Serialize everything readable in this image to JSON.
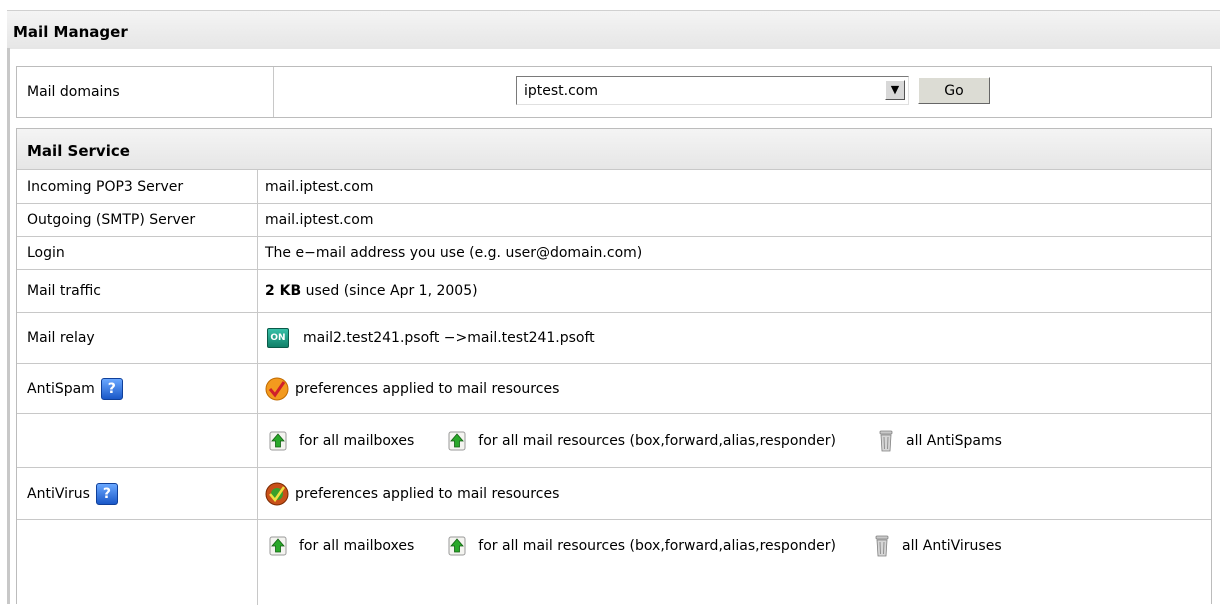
{
  "header": {
    "title": "Mail Manager"
  },
  "domains": {
    "label": "Mail domains",
    "selected": "iptest.com",
    "go_label": "Go"
  },
  "service": {
    "title": "Mail Service",
    "pop3": {
      "label": "Incoming POP3 Server",
      "value": "mail.iptest.com"
    },
    "smtp": {
      "label": "Outgoing (SMTP) Server",
      "value": "mail.iptest.com"
    },
    "login": {
      "label": "Login",
      "value": "The e−mail address you use (e.g. user@domain.com)"
    },
    "traffic": {
      "label": "Mail traffic",
      "amount": "2 KB",
      "rest": "used (since Apr 1, 2005)"
    },
    "relay": {
      "label": "Mail relay",
      "badge": "ON",
      "value": "mail2.test241.psoft −>mail.test241.psoft"
    },
    "antispam": {
      "label": "AntiSpam",
      "help": "?",
      "prefs": "preferences applied to mail resources",
      "all_mailboxes": "for all mailboxes",
      "all_resources": "for all mail resources (box,forward,alias,responder)",
      "delete_all": "all AntiSpams"
    },
    "antivirus": {
      "label": "AntiVirus",
      "help": "?",
      "prefs": "preferences applied to mail resources",
      "all_mailboxes": "for all mailboxes",
      "all_resources": "for all mail resources (box,forward,alias,responder)",
      "delete_all": "all AntiViruses"
    }
  },
  "icons": {
    "help": "help-icon",
    "relay_status": "on-badge-icon",
    "antispam_prefs": "antispam-icon",
    "antivirus_prefs": "antivirus-icon",
    "apply": "apply-up-arrow-icon",
    "delete": "trash-icon"
  }
}
